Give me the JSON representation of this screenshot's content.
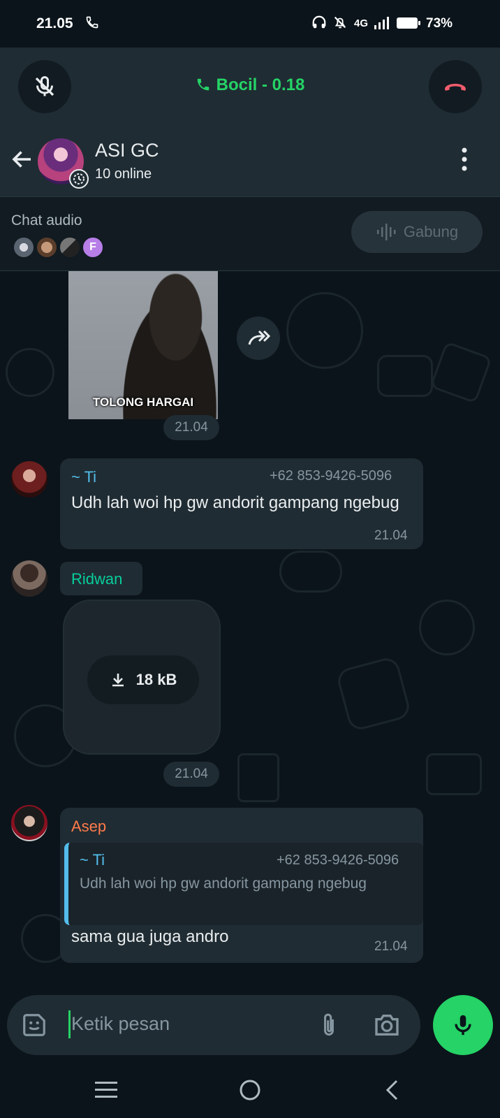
{
  "status_bar": {
    "time": "21.05",
    "network": "4G",
    "battery": "73%"
  },
  "call": {
    "title": "Bocil - 0.18"
  },
  "header": {
    "name": "ASI GC",
    "subtitle": "10 online"
  },
  "audio_chat": {
    "label": "Chat audio",
    "join_label": "Gabung",
    "extra_participant_initial": "F"
  },
  "messages": {
    "image_caption": "TOLONG HARGAI",
    "image_time": "21.04",
    "m1": {
      "sender": "~ Ti",
      "phone": "+62 853-9426-5096",
      "text": "Udh lah woi hp gw andorit gampang ngebug",
      "time": "21.04"
    },
    "m2": {
      "sender": "Ridwan",
      "size": "18 kB",
      "time": "21.04"
    },
    "m3": {
      "sender": "Asep",
      "quote_sender": "~ Ti",
      "quote_phone": "+62 853-9426-5096",
      "quote_text": "Udh lah woi hp gw andorit gampang ngebug",
      "text": "sama gua juga andro",
      "time": "21.04"
    }
  },
  "input": {
    "placeholder": "Ketik pesan"
  },
  "colors": {
    "accent": "#25d366",
    "bubble": "#202c33",
    "background": "#0b141a",
    "sender_ridwan": "#06cf9c",
    "sender_asep": "#ff7b4a",
    "sender_ti": "#53bdeb",
    "end_call": "#f15c6d"
  }
}
